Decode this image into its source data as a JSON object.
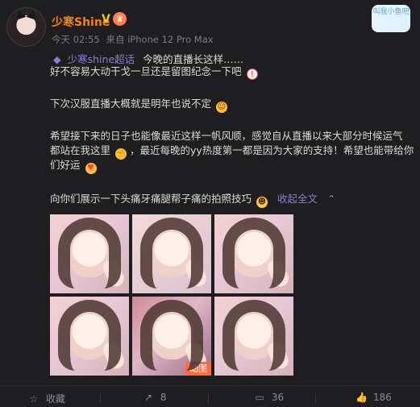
{
  "header": {
    "username": "少寒Shine",
    "badge": "V",
    "time": "今天 02:55",
    "source": "来自 iPhone 12 Pro Max",
    "sticker_text": "叫我小鱼吧"
  },
  "topic": {
    "tag": "少寒shine超话",
    "text": "今晚的直播长这样……"
  },
  "content": {
    "line1": "好不容易大动干戈一旦还是留图纪念一下吧",
    "line2": "下次汉服直播大概就是明年也说不定",
    "line3": "希望接下来的日子也能像最近这样一帆风顺，感觉自从直播以来大部分时候运气",
    "line4a": "都站在我这里",
    "line4b": "，最近每晚的yy热度第一都是因为大家的支持！希望也能带给你",
    "line5": "们好运",
    "line6": "向你们展示一下头痛牙痛腿帮子痛的拍照技巧",
    "collapse": "收起全文"
  },
  "gallery": {
    "gif_label": "动图"
  },
  "footer": {
    "favorite": "收藏",
    "repost": "8",
    "comment": "36",
    "like": "186"
  }
}
